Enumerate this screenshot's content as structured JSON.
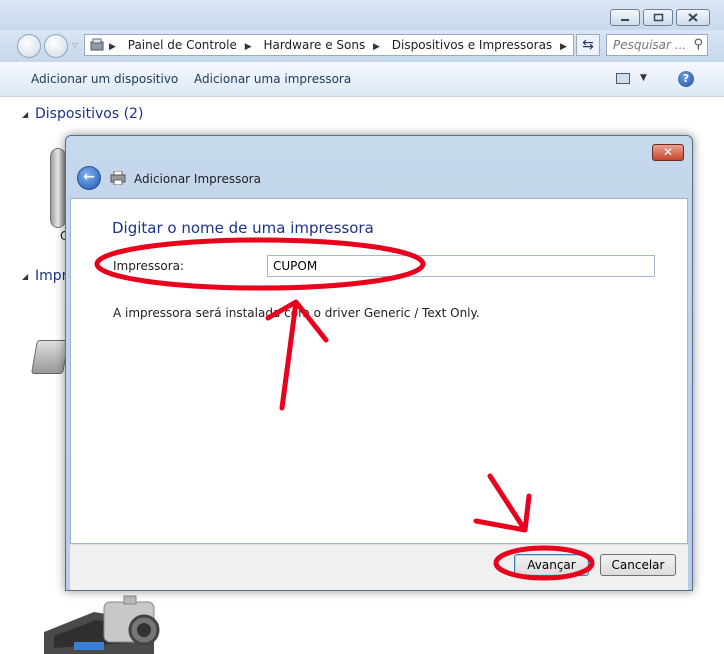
{
  "explorer": {
    "breadcrumb": [
      "Painel de Controle",
      "Hardware e Sons",
      "Dispositivos e Impressoras"
    ],
    "search_placeholder": "Pesquisar ...",
    "commands": {
      "add_device": "Adicionar um dispositivo",
      "add_printer": "Adicionar uma impressora"
    },
    "groups": {
      "devices": "Dispositivos (2)",
      "printers": "Impr",
      "device_label_fragment": "C"
    }
  },
  "dialog": {
    "title": "Adicionar Impressora",
    "close_glyph": "✕",
    "back_glyph": "←",
    "heading": "Digitar o nome de uma impressora",
    "printer_label": "Impressora:",
    "printer_value": "CUPOM",
    "driver_note": "A impressora será instalada com o driver Generic / Text Only.",
    "next_label": "Avançar",
    "cancel_label": "Cancelar"
  },
  "colors": {
    "annotation": "#e8001c",
    "heading_blue": "#1e3287"
  }
}
